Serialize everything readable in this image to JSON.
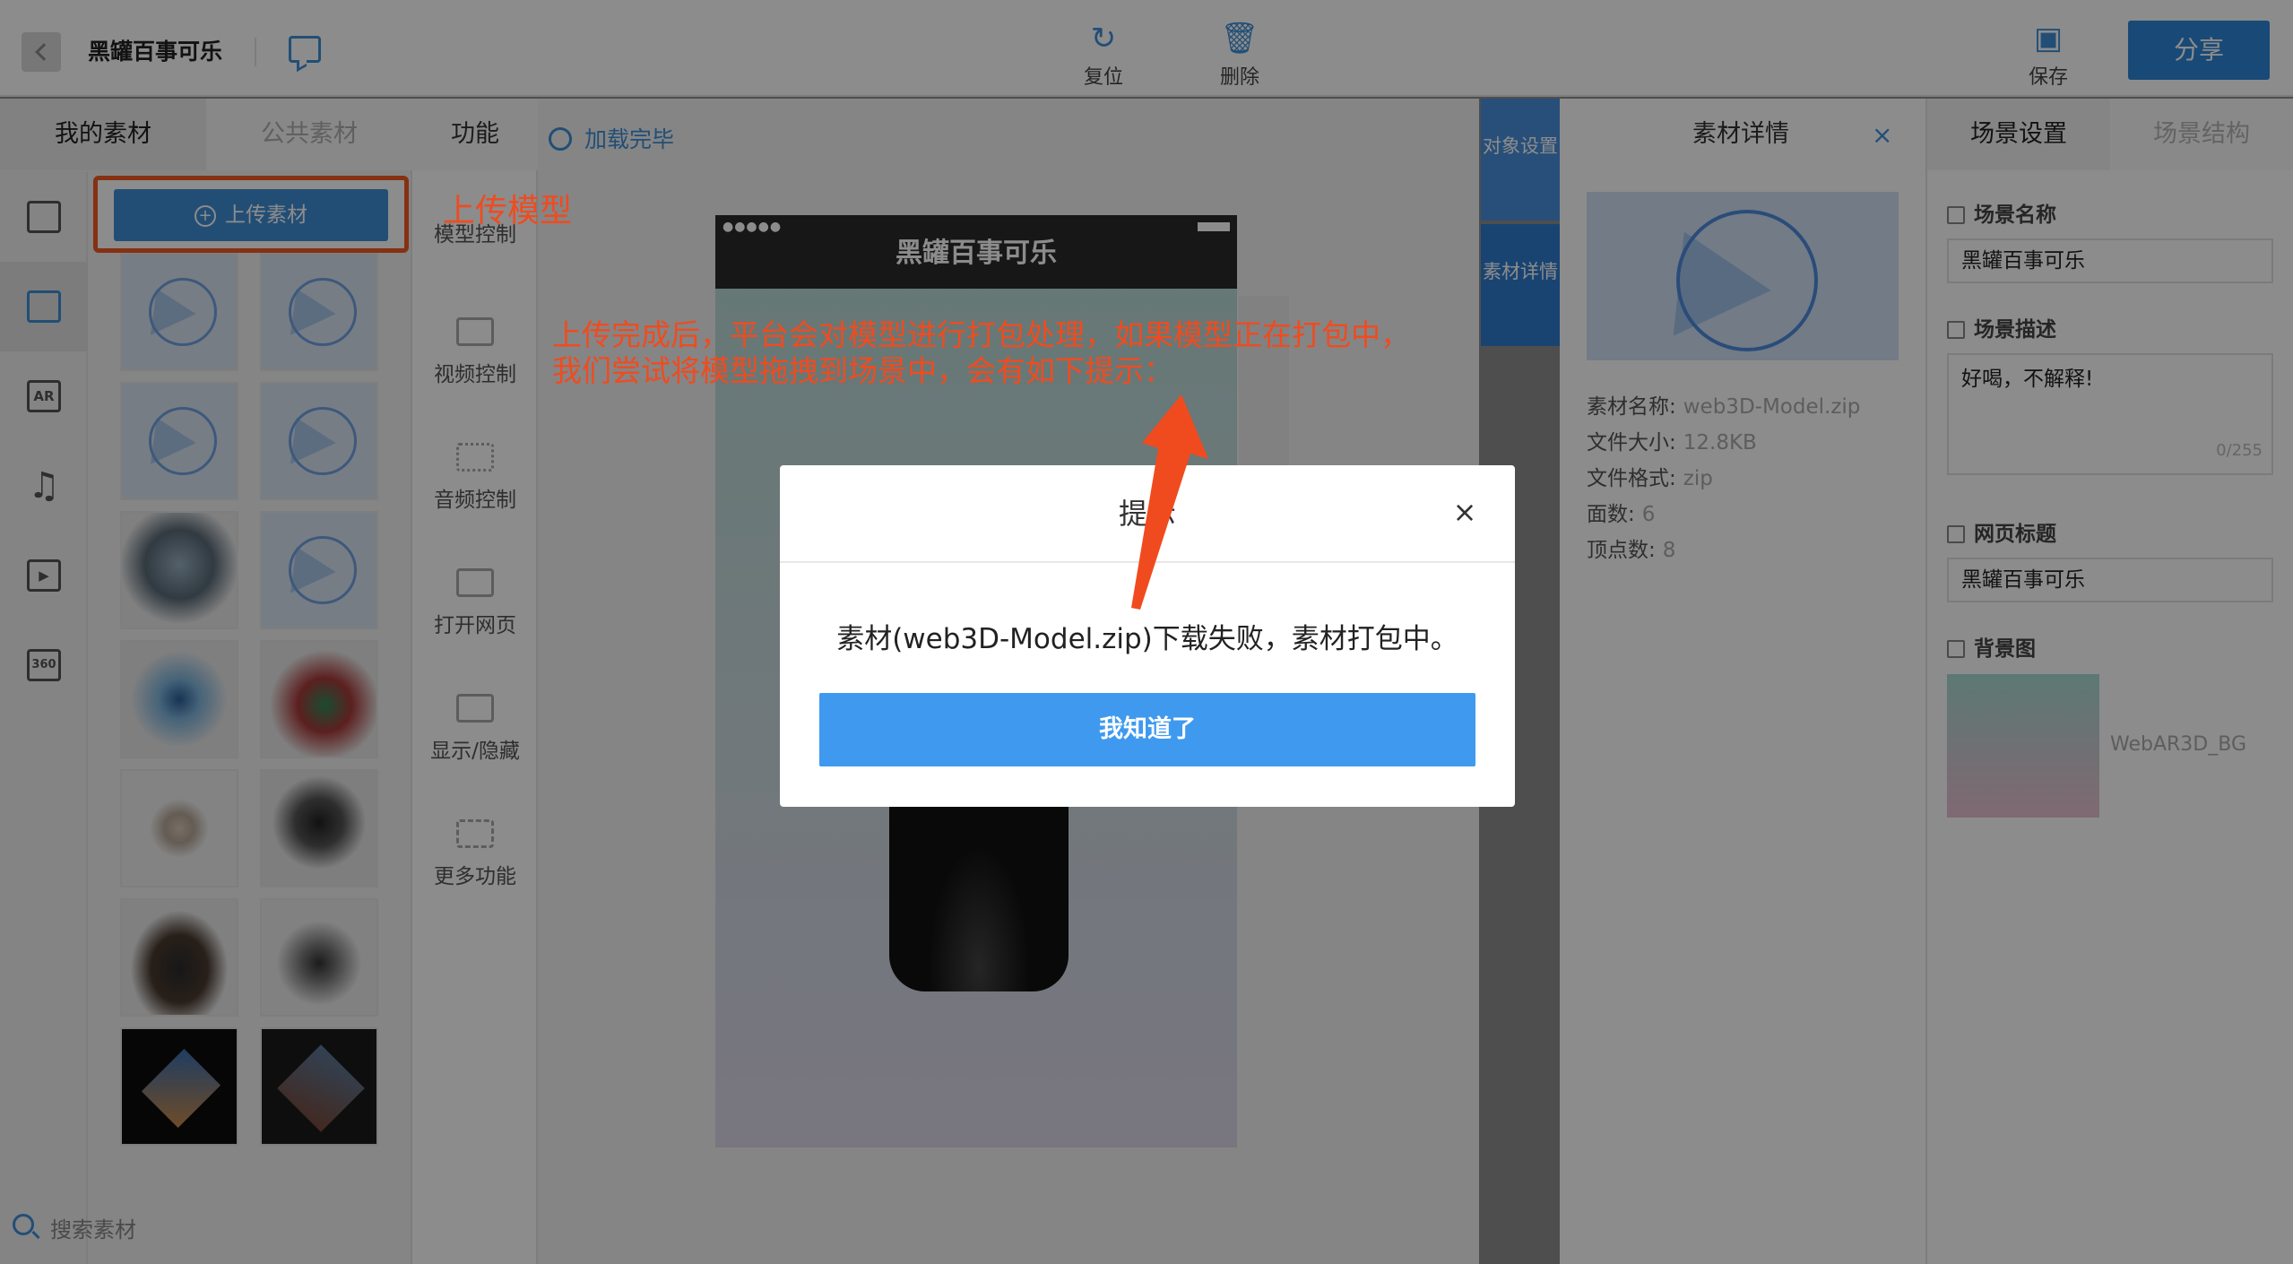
{
  "header": {
    "project_name": "黑罐百事可乐",
    "tools": [
      {
        "label": "复位",
        "icon": "refresh-icon"
      },
      {
        "label": "删除",
        "icon": "trash-icon"
      }
    ],
    "save_label": "保存",
    "share_label": "分享"
  },
  "library": {
    "tabs": [
      "我的素材",
      "公共素材"
    ],
    "rail_icons": [
      "image-chart-icon",
      "cube-icon",
      "ar-icon",
      "music-note-icon",
      "video-icon",
      "360-icon"
    ],
    "rail_labels": {
      "ar": "AR",
      "pano": "360"
    },
    "upload_label": "上传素材",
    "search_placeholder": "搜索素材"
  },
  "functions": {
    "title": "功能",
    "items": [
      "模型控制",
      "视频控制",
      "音频控制",
      "打开网页",
      "显示/隐藏",
      "更多功能"
    ]
  },
  "canvas": {
    "load_status": "加载完毕",
    "phone_title": "黑罐百事可乐",
    "side_buttons": [
      "对象设置",
      "素材详情"
    ]
  },
  "detail": {
    "title": "素材详情",
    "fields": [
      {
        "key": "素材名称:",
        "value": "web3D-Model.zip"
      },
      {
        "key": "文件大小:",
        "value": "12.8KB"
      },
      {
        "key": "文件格式:",
        "value": "zip"
      },
      {
        "key": "面数:",
        "value": "6"
      },
      {
        "key": "顶点数:",
        "value": "8"
      }
    ]
  },
  "scene": {
    "tabs": [
      "场景设置",
      "场景结构"
    ],
    "name_label": "场景名称",
    "name_value": "黑罐百事可乐",
    "desc_label": "场景描述",
    "desc_value": "好喝，不解释!",
    "desc_count": "0/255",
    "page_title_label": "网页标题",
    "page_title_value": "黑罐百事可乐",
    "bg_label": "背景图",
    "bg_name": "WebAR3D_BG"
  },
  "annotations": {
    "upload_note": "上传模型",
    "process_note_line1": "上传完成后，平台会对模型进行打包处理，如果模型正在打包中，",
    "process_note_line2": "我们尝试将模型拖拽到场景中，会有如下提示："
  },
  "modal": {
    "title": "提示",
    "message": "素材(web3D-Model.zip)下载失败，素材打包中。",
    "confirm_label": "我知道了"
  },
  "colors": {
    "accent": "#3f8fd8",
    "annotation": "#f04b1f",
    "modal_button": "#3f9aef"
  }
}
